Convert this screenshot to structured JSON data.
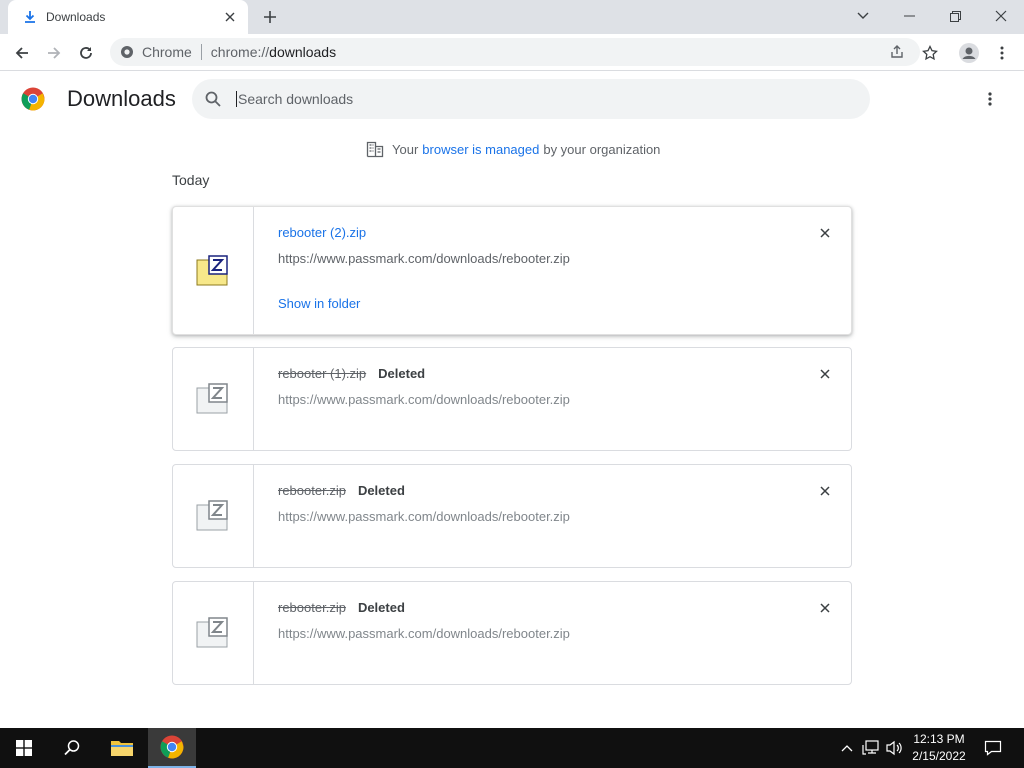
{
  "tab": {
    "title": "Downloads"
  },
  "window": {
    "controls": [
      "chevron-down",
      "minimize",
      "restore",
      "close"
    ]
  },
  "omnibox": {
    "site_label": "Chrome",
    "url_scheme": "chrome://",
    "url_path": "downloads"
  },
  "header": {
    "title": "Downloads",
    "search_placeholder": "Search downloads"
  },
  "managed": {
    "prefix": "Your",
    "link": "browser is managed",
    "suffix": "by your organization"
  },
  "section": {
    "title": "Today"
  },
  "downloads": [
    {
      "name": "rebooter (2).zip",
      "status": "",
      "url": "https://www.passmark.com/downloads/rebooter.zip",
      "action": "Show in folder",
      "deleted": false
    },
    {
      "name": "rebooter (1).zip",
      "status": "Deleted",
      "url": "https://www.passmark.com/downloads/rebooter.zip",
      "action": "",
      "deleted": true
    },
    {
      "name": "rebooter.zip",
      "status": "Deleted",
      "url": "https://www.passmark.com/downloads/rebooter.zip",
      "action": "",
      "deleted": true
    },
    {
      "name": "rebooter.zip",
      "status": "Deleted",
      "url": "https://www.passmark.com/downloads/rebooter.zip",
      "action": "",
      "deleted": true
    }
  ],
  "taskbar": {
    "time": "12:13 PM",
    "date": "2/15/2022"
  },
  "colors": {
    "link": "#1a73e8",
    "tabstrip": "#dee1e6",
    "taskbar": "#101010"
  }
}
